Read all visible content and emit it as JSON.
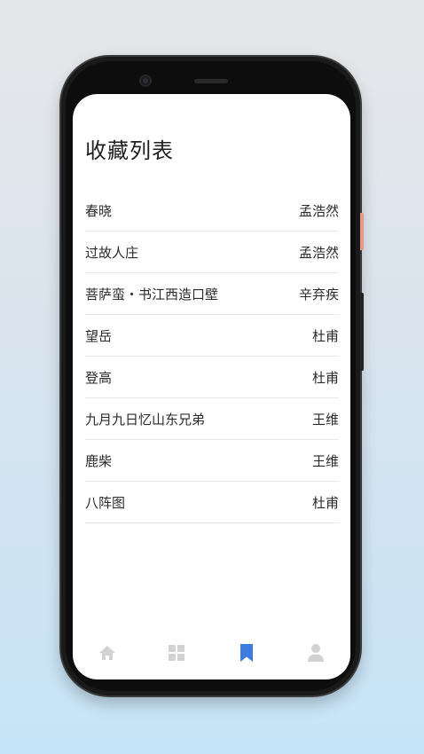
{
  "page": {
    "title": "收藏列表"
  },
  "favorites": [
    {
      "title": "春晓",
      "author": "孟浩然"
    },
    {
      "title": "过故人庄",
      "author": "孟浩然"
    },
    {
      "title": "菩萨蛮・书江西造口壁",
      "author": "辛弃疾"
    },
    {
      "title": "望岳",
      "author": "杜甫"
    },
    {
      "title": "登高",
      "author": "杜甫"
    },
    {
      "title": "九月九日忆山东兄弟",
      "author": "王维"
    },
    {
      "title": "鹿柴",
      "author": "王维"
    },
    {
      "title": "八阵图",
      "author": "杜甫"
    }
  ],
  "tabbar": {
    "items": [
      {
        "icon": "home-icon",
        "active": false
      },
      {
        "icon": "grid-icon",
        "active": false
      },
      {
        "icon": "bookmark-icon",
        "active": true
      },
      {
        "icon": "user-icon",
        "active": false
      }
    ],
    "active_color": "#3d7be0",
    "inactive_color": "#d2d2d2"
  }
}
